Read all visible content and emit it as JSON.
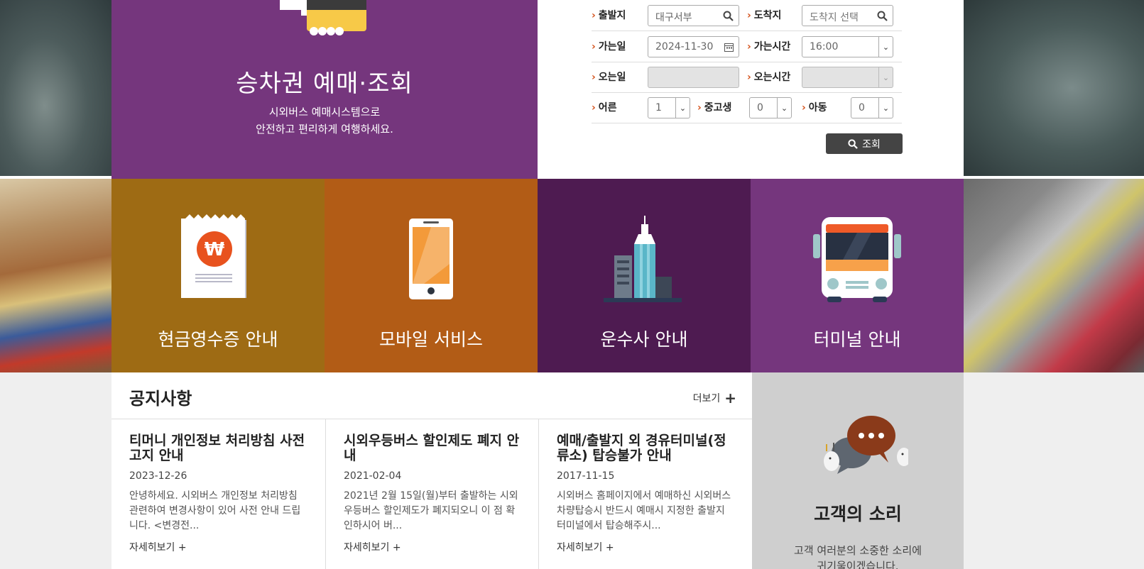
{
  "hero": {
    "title": "승차권 예매·조회",
    "desc_line1": "시외버스 예매시스템으로",
    "desc_line2": "안전하고 편리하게 여행하세요."
  },
  "booking": {
    "departure_label": "출발지",
    "departure_value": "대구서부",
    "arrival_label": "도착지",
    "arrival_placeholder": "도착지 선택",
    "go_date_label": "가는일",
    "go_date_value": "2024-11-30",
    "go_time_label": "가는시간",
    "go_time_value": "16:00",
    "return_date_label": "오는일",
    "return_time_label": "오는시간",
    "adult_label": "어른",
    "adult_value": "1",
    "student_label": "중고생",
    "student_value": "0",
    "child_label": "아동",
    "child_value": "0",
    "search_label": "조회"
  },
  "tiles": [
    {
      "label": "현금영수증 안내",
      "icon": "receipt-icon",
      "color": "#9e6b14"
    },
    {
      "label": "모바일 서비스",
      "icon": "smartphone-icon",
      "color": "#b25c16"
    },
    {
      "label": "운수사 안내",
      "icon": "building-icon",
      "color": "#4e1b51"
    },
    {
      "label": "터미널 안내",
      "icon": "bus-icon",
      "color": "#75367d"
    }
  ],
  "notices": {
    "title": "공지사항",
    "more": "더보기",
    "items": [
      {
        "title": "티머니 개인정보 처리방침 사전고지 안내",
        "date": "2023-12-26",
        "body": "안녕하세요. 시외버스 개인정보 처리방침 관련하여 변경사항이 있어 사전 안내 드립니다. <변경전...",
        "more": "자세히보기"
      },
      {
        "title": "시외우등버스 할인제도 폐지 안내",
        "date": "2021-02-04",
        "body": "2021년 2월 15일(월)부터 출발하는 시외우등버스 할인제도가 폐지되오니 이 점 확인하시어 버...",
        "more": "자세히보기"
      },
      {
        "title": "예매/출발지 외 경유터미널(정류소) 탑승불가 안내",
        "date": "2017-11-15",
        "body": "시외버스 홈페이지에서 예매하신 시외버스 차량탑승시 반드시 예매시 지정한 출발지 터미널에서 탑승해주시...",
        "more": "자세히보기"
      }
    ]
  },
  "voice": {
    "title": "고객의 소리",
    "desc_line1": "고객 여러분의 소중한 소리에",
    "desc_line2": "귀기울이겠습니다."
  },
  "colors": {
    "hero_purple": "#75367d",
    "accent_orange": "#d4521c",
    "search_button": "#444444"
  }
}
